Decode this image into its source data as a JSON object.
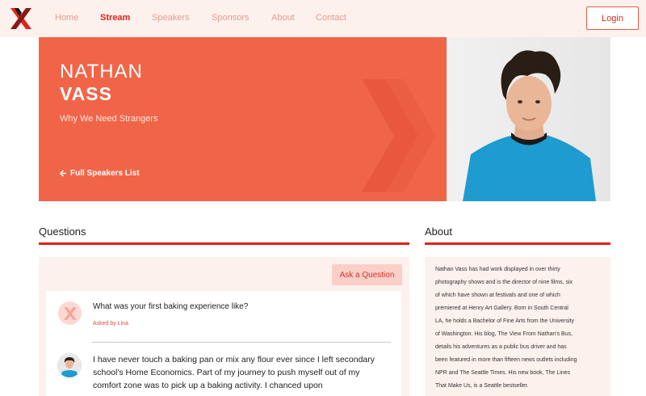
{
  "nav": {
    "items": [
      "Home",
      "Stream",
      "Speakers",
      "Sponsors",
      "About",
      "Contact"
    ],
    "active": "Stream",
    "login_label": "Login",
    "logo_icon": "tedx-x-logo-icon"
  },
  "hero": {
    "first_name": "NATHAN",
    "last_name": "VASS",
    "talk_title": "Why We Need Strangers",
    "back_label": "Full Speakers List",
    "back_icon": "arrow-left-icon"
  },
  "questions": {
    "title": "Questions",
    "ask_label": "Ask a Question",
    "question_text": "What was your first baking experience like?",
    "asked_by": "Asked by Lina",
    "answer_lines": [
      "I have never touch a baking pan or mix any flour ever since I left secondary",
      "school's Home Economics. Part of my journey to push myself out of my",
      "comfort zone was to pick up a baking activity. I chanced upon"
    ]
  },
  "about": {
    "title": "About",
    "lines": [
      "Nathan Vass has had work displayed in over thirty",
      "photography shows and is the director of nine films, six",
      "of which have shown at festivals and one of which",
      "premiered at Henry Art Gallery. Born in South Central",
      "LA, he holds a Bachelor of Fine Arts from the University",
      "of Washington. His blog, The View From Nathan's Bus,",
      "details his adventures as a public bus driver and has",
      "been featured in more than fifteen news outlets including",
      "NPR and The Seattle Times. His new book, The Lines",
      "That Make Us, is a Seattle bestseller."
    ]
  },
  "colors": {
    "accent": "#e0231a",
    "hero_bg": "#f06548",
    "panel_bg": "#fdf1ee"
  }
}
